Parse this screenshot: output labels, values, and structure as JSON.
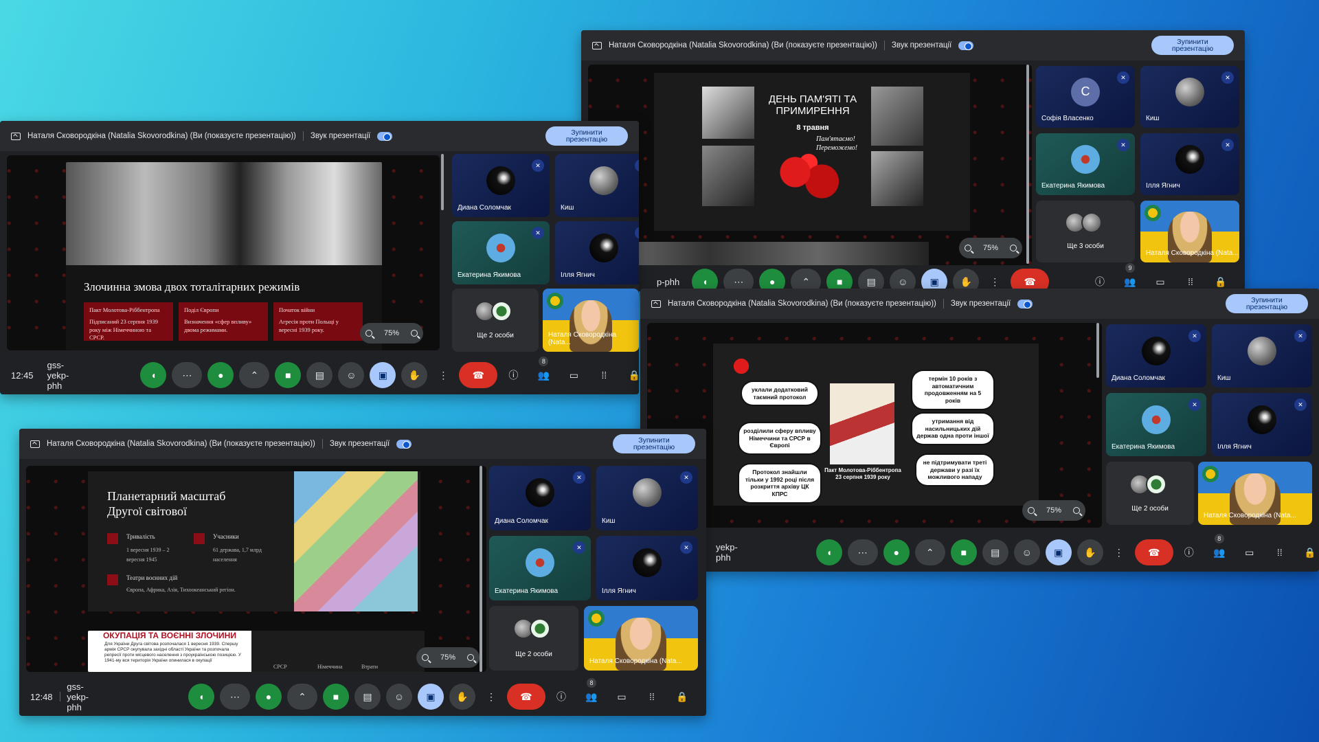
{
  "meeting": {
    "presenter_text": "Наталя Сковородкіна (Natalia Skovorodkina) (Ви (показуєте презентацію))",
    "audio_label": "Звук презентації",
    "stop_button": "Зупинити презентацію",
    "zoom_level": "75%",
    "code_full": "gss-yekp-phh",
    "code_partial_top": "p-phh",
    "code_partial_right": "yekp-phh",
    "participants_count": "8",
    "participants_count_top": "9"
  },
  "window1": {
    "time": "12:45",
    "slide_title": "Злочинна змова двох тоталітарних режимів",
    "boxes": [
      {
        "head": "Пакт Молотова-Ріббентропа",
        "body": "Підписаний 23 серпня 1939 року між Німеччиною та СРСР."
      },
      {
        "head": "Поділ Європи",
        "body": "Визначення «сфер впливу» двома режимами."
      },
      {
        "head": "Початок війни",
        "body": "Агресія проти Польщі у вересні 1939 року."
      }
    ]
  },
  "window2": {
    "slide_title": "ДЕНЬ ПАМ'ЯТІ ТА ПРИМИРЕННЯ",
    "slide_date": "8 травня",
    "slide_script": "Пам'ятаємо! Переможемо!"
  },
  "window3": {
    "bubbles_left": [
      "уклали додатковий таємний протокол",
      "розділили сферу впливу Німеччини та СРСР в Європі",
      "Протокол знайшли тільки у 1992 році після розкриття архіву ЦК КПРС"
    ],
    "bubbles_right": [
      "термін 10 років з автоматичним продовженням на 5 років",
      "утримання від насильницьких дій держав одна проти іншої",
      "не підтримувати треті держави у разі їх можливого нападу"
    ],
    "caption": "Пакт Молотова-Ріббентропа 23 серпня 1939 року"
  },
  "window4": {
    "time": "12:48",
    "slide_title": "Планетарний масштаб Другої світової",
    "items": [
      {
        "head": "Тривалість",
        "body": "1 вересня 1939 – 2 вересня 1945"
      },
      {
        "head": "Учасники",
        "body": "61 держава, 1,7 млрд населення"
      },
      {
        "head": "Театри воєнних дій",
        "body": "Європа, Африка, Азія, Тихоокеанський регіон."
      }
    ],
    "slide2_title": "ОКУПАЦІЯ ТА ВОЄННІ ЗЛОЧИНИ",
    "slide2_text": "Для України Друга світова розпочалася 1 вересня 1939. Спершу армія СРСР окупувала західні області України та розпочала репресії проти місцевого населення з проукраїнською позицією. У 1941-му вся територія України опинилася в окупації",
    "slide2_cols": [
      "СРСР",
      "Німеччина",
      "Втрати"
    ]
  },
  "participants": {
    "dyana": "Диана Соломчак",
    "kysh": "Киш",
    "kateryna": "Екатерина Якимова",
    "illia": "Ілля Ягнич",
    "sofia": "Софія Власенко",
    "sofia_initial": "C",
    "more2": "Ще 2 особи",
    "more3": "Ще 3 особи",
    "self": "Наталя Сковородкіна (Nata..."
  },
  "icons": [
    "present-icon",
    "zoom-out-icon",
    "zoom-in-icon",
    "mic-off-icon",
    "volume-icon",
    "mic-icon",
    "camera-icon",
    "captions-icon",
    "emoji-icon",
    "present-screen-icon",
    "raise-hand-icon",
    "more-icon",
    "end-call-icon",
    "info-icon",
    "people-icon",
    "chat-icon",
    "apps-icon",
    "lock-icon"
  ]
}
